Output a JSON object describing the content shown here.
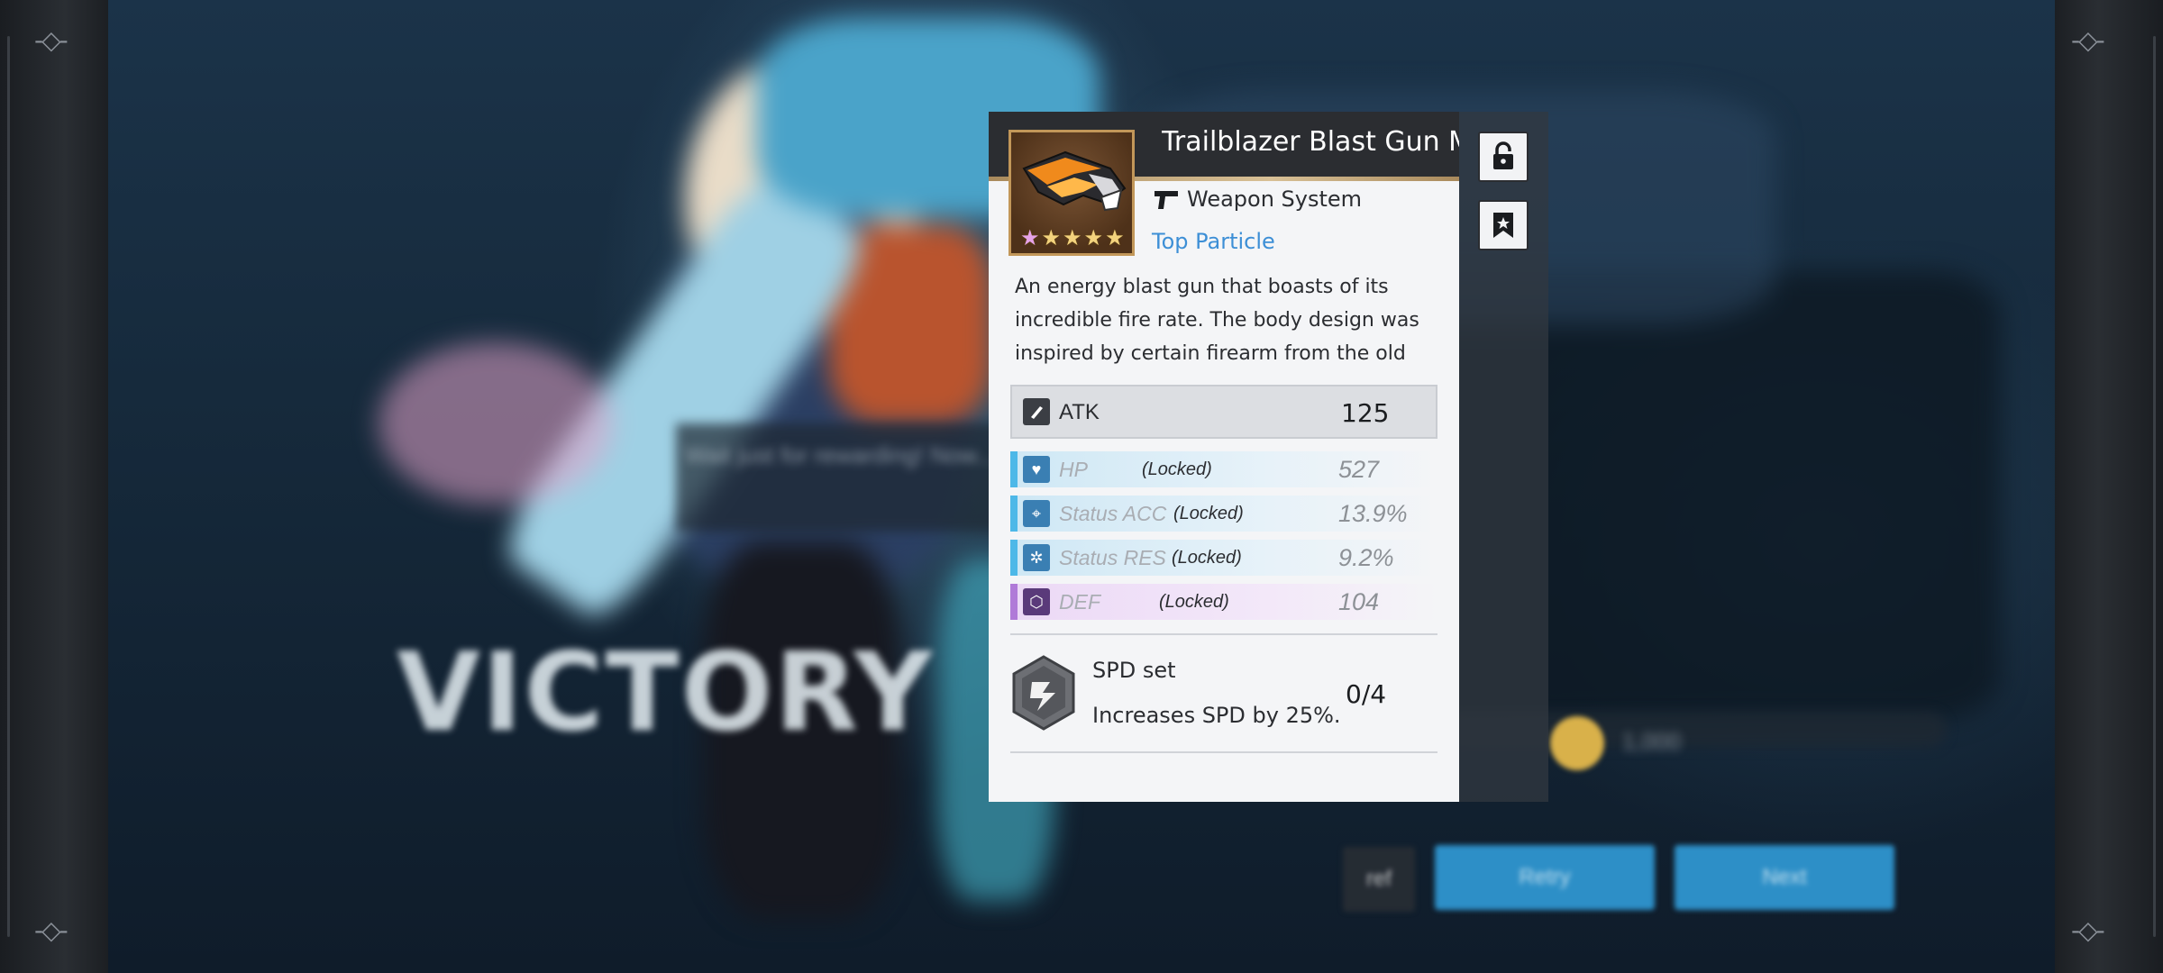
{
  "background": {
    "victory_text": "VICTORY",
    "blurred_dialog_text": "Wait just for rewarding! Now...",
    "coin_value": "1,000",
    "buttons": [
      {
        "label": "ref"
      },
      {
        "label": "Retry"
      },
      {
        "label": "Next"
      }
    ]
  },
  "item": {
    "name": "Trailblazer Blast Gun M",
    "type_icon": "pistol-icon",
    "type_label": "Weapon System",
    "rarity_label": "Top Particle",
    "stars": 5,
    "description_lines": [
      "An energy blast gun that boasts of its",
      "incredible fire rate. The body design was",
      "inspired by certain firearm from the old"
    ],
    "main_stat": {
      "label": "ATK",
      "value": "125",
      "icon": "atk-icon"
    },
    "substats": [
      {
        "label": "HP",
        "lock": "(Locked)",
        "value": "527",
        "icon": "heart-icon",
        "color": "#4db8e8",
        "tint": "#cfe8f5"
      },
      {
        "label": "Status ACC",
        "lock": "(Locked)",
        "value": "13.9%",
        "icon": "crosshair-icon",
        "color": "#4db8e8",
        "tint": "#cfe8f5"
      },
      {
        "label": "Status RES",
        "lock": "(Locked)",
        "value": "9.2%",
        "icon": "shield-gear-icon",
        "color": "#4db8e8",
        "tint": "#cfe8f5"
      },
      {
        "label": "DEF",
        "lock": "(Locked)",
        "value": "104",
        "icon": "hexagon-icon",
        "color": "#b07ad8",
        "tint": "#ecd9f6"
      }
    ],
    "set": {
      "name": "SPD set",
      "description": "Increases SPD by 25%.",
      "progress": "0/4",
      "icon": "speed-set-icon"
    }
  },
  "side_buttons": [
    {
      "icon": "unlock-icon"
    },
    {
      "icon": "bookmark-star-icon"
    }
  ],
  "colors": {
    "accent_gold": "#c29759",
    "rarity_blue": "#3d8fd6",
    "header_dark": "#2b2d31"
  }
}
